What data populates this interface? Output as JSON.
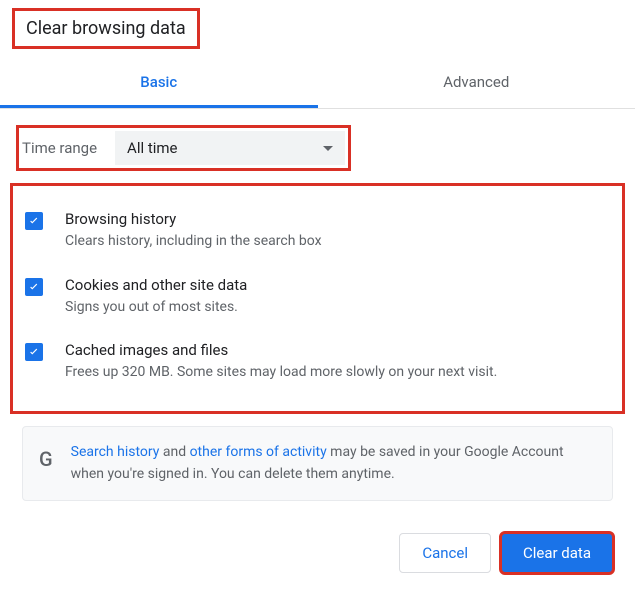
{
  "title": "Clear browsing data",
  "tabs": {
    "basic": "Basic",
    "advanced": "Advanced"
  },
  "timeRange": {
    "label": "Time range",
    "value": "All time"
  },
  "options": [
    {
      "title": "Browsing history",
      "desc": "Clears history, including in the search box"
    },
    {
      "title": "Cookies and other site data",
      "desc": "Signs you out of most sites."
    },
    {
      "title": "Cached images and files",
      "desc": "Frees up 320 MB. Some sites may load more slowly on your next visit."
    }
  ],
  "info": {
    "link1": "Search history",
    "mid1": " and ",
    "link2": "other forms of activity",
    "mid2": " may be saved in your Google Account when you're signed in. You can delete them anytime."
  },
  "buttons": {
    "cancel": "Cancel",
    "clear": "Clear data"
  }
}
